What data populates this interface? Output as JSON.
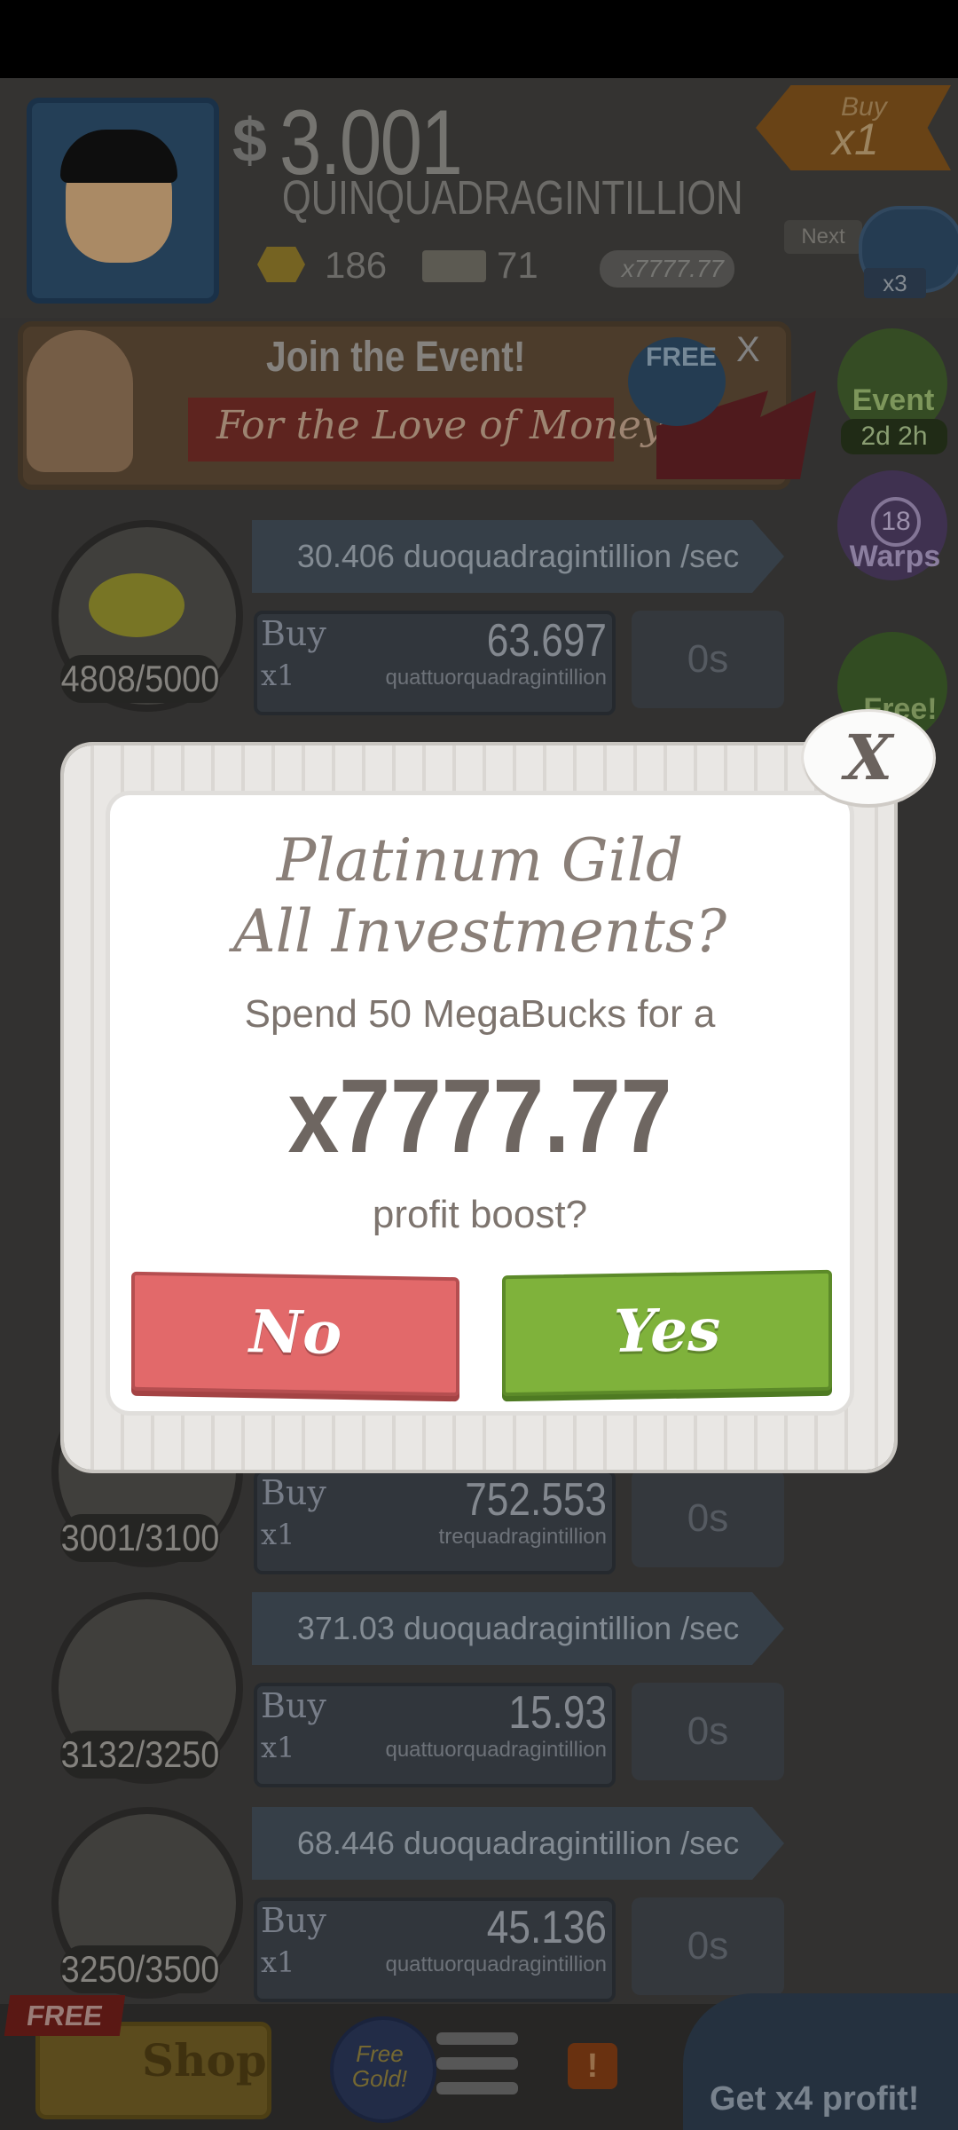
{
  "header": {
    "currency_symbol": "$",
    "money_value": "3.001",
    "money_unit": "QUINQUADRAGINTILLION",
    "gold_count": "186",
    "tickets_count": "71",
    "ticket_multiplier": "x7777.77",
    "buy_tag_label": "Buy",
    "buy_tag_value": "x1",
    "next_label": "Next",
    "next_multiplier": "x3"
  },
  "event_banner": {
    "title": "Join the Event!",
    "subtitle": "For the Love of Money",
    "free_badge": "FREE",
    "close": "X"
  },
  "sidebar": {
    "event_label": "Event",
    "event_time": "2d 2h",
    "warps_count": "18",
    "warps_label": "Warps",
    "free_label": "Free!"
  },
  "businesses": [
    {
      "rate": "30.406 duoquadragintillion /sec",
      "count": "4808/5000",
      "buy": "Buy",
      "mult": "x1",
      "cost": "63.697",
      "unit": "quattuorquadragintillion",
      "timer": "0s"
    },
    {
      "rate": "",
      "count": "3001/3100",
      "buy": "Buy",
      "mult": "x1",
      "cost": "752.553",
      "unit": "trequadragintillion",
      "timer": "0s"
    },
    {
      "rate": "371.03 duoquadragintillion /sec",
      "count": "3132/3250",
      "buy": "Buy",
      "mult": "x1",
      "cost": "15.93",
      "unit": "quattuorquadragintillion",
      "timer": "0s"
    },
    {
      "rate": "68.446 duoquadragintillion /sec",
      "count": "3250/3500",
      "buy": "Buy",
      "mult": "x1",
      "cost": "45.136",
      "unit": "quattuorquadragintillion",
      "timer": "0s"
    }
  ],
  "bottom_bar": {
    "free_ribbon": "FREE",
    "shop_label": "Shop",
    "free_gold": "Free Gold!",
    "alert": "!",
    "x4_profit": "Get x4 profit!"
  },
  "dialog": {
    "title_line1": "Platinum Gild",
    "title_line2": "All Investments?",
    "spend_text": "Spend 50 MegaBucks for a",
    "multiplier": "x7777.77",
    "profit_text": "profit boost?",
    "no_label": "No",
    "yes_label": "Yes",
    "close_label": "X"
  },
  "colors": {
    "no_button": "#e2696a",
    "yes_button": "#7fb23b",
    "dialog_text": "#7d746e"
  }
}
